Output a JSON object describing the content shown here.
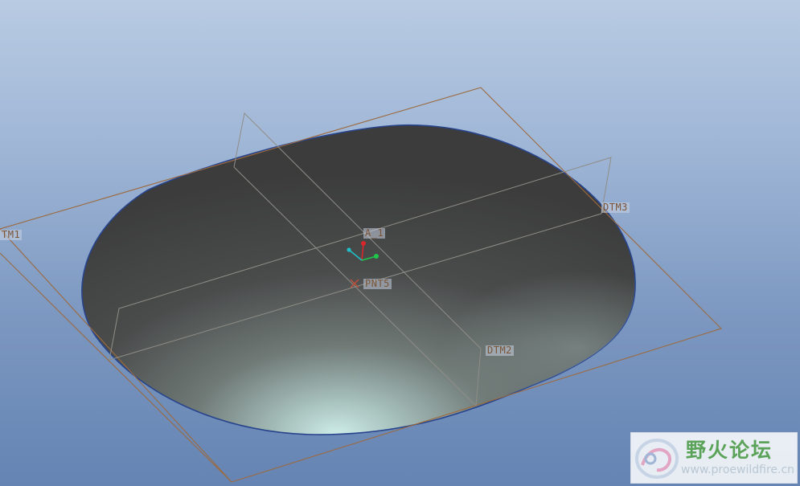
{
  "viewport": {
    "part_name": "",
    "datum_labels": {
      "dtm1": "TM1",
      "dtm2": "DTM2",
      "dtm3": "DTM3",
      "axis": "A_1",
      "point": "PNT5"
    }
  },
  "watermark": {
    "title": "野火论坛",
    "url": "www.proewildfire.cn"
  },
  "colors": {
    "datum_plane": "#9c6a3f",
    "background_top": "#b9cbe3",
    "background_bottom": "#6584b3",
    "surface_dark": "#3a3a3a",
    "surface_highlight": "#c6e6e3",
    "csys_x": "#1ec84a",
    "csys_y": "#d8262c",
    "csys_z": "#20c0c8"
  },
  "icons": [
    "csys-icon",
    "datum-point-x-icon",
    "forum-logo-icon"
  ]
}
